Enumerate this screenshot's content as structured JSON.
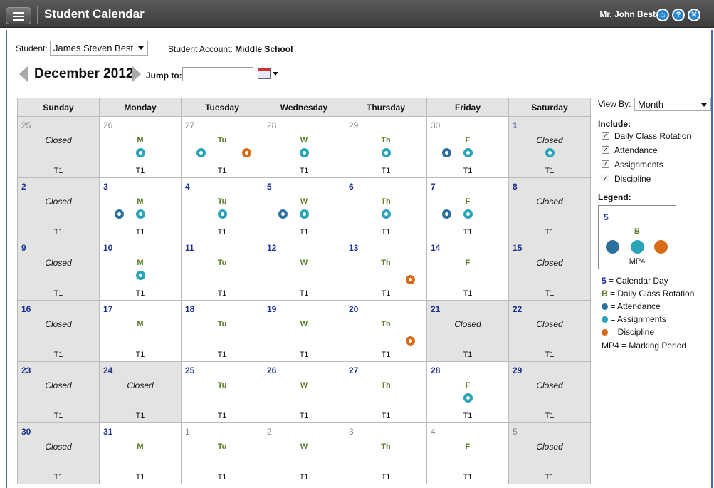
{
  "app": {
    "title": "Student Calendar",
    "user": "Mr. John Best"
  },
  "toolbar": {
    "home_icon": "home-icon",
    "help_icon": "help-icon",
    "close_icon": "close-icon"
  },
  "student": {
    "label": "Student:",
    "value": "James Steven Best",
    "account_label": "Student Account:",
    "account_value": "Middle School"
  },
  "nav": {
    "month": "December 2012",
    "jump_label": "Jump to:",
    "jump_value": ""
  },
  "calendar": {
    "weekdays": [
      "Sunday",
      "Monday",
      "Tuesday",
      "Wednesday",
      "Thursday",
      "Friday",
      "Saturday"
    ],
    "weeks": [
      [
        {
          "d": "25",
          "other": true,
          "closed": true,
          "mp": "T1"
        },
        {
          "d": "26",
          "other": true,
          "rot": "M",
          "icons": [
            "asg"
          ],
          "mp": "T1"
        },
        {
          "d": "27",
          "other": true,
          "rot": "Tu",
          "icons": [
            "asg",
            "dis"
          ],
          "mp": "T1"
        },
        {
          "d": "28",
          "other": true,
          "rot": "W",
          "icons": [
            "asg"
          ],
          "mp": "T1"
        },
        {
          "d": "29",
          "other": true,
          "rot": "Th",
          "icons": [
            "asg"
          ],
          "mp": "T1"
        },
        {
          "d": "30",
          "other": true,
          "rot": "F",
          "icons": [
            "att",
            "asg"
          ],
          "mp": "T1"
        },
        {
          "d": "1",
          "closed": true,
          "icons": [
            "asg"
          ],
          "mp": "T1"
        }
      ],
      [
        {
          "d": "2",
          "closed": true,
          "mp": "T1"
        },
        {
          "d": "3",
          "rot": "M",
          "icons": [
            "att",
            "asg"
          ],
          "mp": "T1"
        },
        {
          "d": "4",
          "rot": "Tu",
          "icons": [
            "asg"
          ],
          "mp": "T1"
        },
        {
          "d": "5",
          "rot": "W",
          "icons": [
            "att",
            "asg"
          ],
          "mp": "T1"
        },
        {
          "d": "6",
          "rot": "Th",
          "icons": [
            "asg"
          ],
          "mp": "T1"
        },
        {
          "d": "7",
          "rot": "F",
          "icons": [
            "att",
            "asg"
          ],
          "mp": "T1"
        },
        {
          "d": "8",
          "closed": true,
          "mp": "T1"
        }
      ],
      [
        {
          "d": "9",
          "closed": true,
          "mp": "T1"
        },
        {
          "d": "10",
          "rot": "M",
          "icons": [
            "asg"
          ],
          "mp": "T1"
        },
        {
          "d": "11",
          "rot": "Tu",
          "mp": "T1"
        },
        {
          "d": "12",
          "rot": "W",
          "mp": "T1"
        },
        {
          "d": "13",
          "rot": "Th",
          "icons": [
            "dis"
          ],
          "mp": "T1"
        },
        {
          "d": "14",
          "rot": "F",
          "mp": "T1"
        },
        {
          "d": "15",
          "closed": true,
          "mp": "T1"
        }
      ],
      [
        {
          "d": "16",
          "closed": true,
          "mp": "T1"
        },
        {
          "d": "17",
          "rot": "M",
          "mp": "T1"
        },
        {
          "d": "18",
          "rot": "Tu",
          "mp": "T1"
        },
        {
          "d": "19",
          "rot": "W",
          "mp": "T1"
        },
        {
          "d": "20",
          "rot": "Th",
          "icons": [
            "dis"
          ],
          "mp": "T1"
        },
        {
          "d": "21",
          "closed": true,
          "mp": "T1"
        },
        {
          "d": "22",
          "closed": true,
          "mp": "T1"
        }
      ],
      [
        {
          "d": "23",
          "closed": true,
          "mp": "T1"
        },
        {
          "d": "24",
          "closed": true,
          "mp": "T1"
        },
        {
          "d": "25",
          "rot": "Tu",
          "mp": "T1"
        },
        {
          "d": "26",
          "rot": "W",
          "mp": "T1"
        },
        {
          "d": "27",
          "rot": "Th",
          "mp": "T1"
        },
        {
          "d": "28",
          "rot": "F",
          "icons": [
            "asg"
          ],
          "mp": "T1"
        },
        {
          "d": "29",
          "closed": true,
          "mp": "T1"
        }
      ],
      [
        {
          "d": "30",
          "closed": true,
          "mp": "T1"
        },
        {
          "d": "31",
          "rot": "M",
          "mp": "T1"
        },
        {
          "d": "1",
          "other": true,
          "rot": "Tu",
          "mp": "T1"
        },
        {
          "d": "2",
          "other": true,
          "rot": "W",
          "mp": "T1"
        },
        {
          "d": "3",
          "other": true,
          "rot": "Th",
          "mp": "T1"
        },
        {
          "d": "4",
          "other": true,
          "rot": "F",
          "mp": "T1"
        },
        {
          "d": "5",
          "other": true,
          "closed": true,
          "mp": "T1"
        }
      ]
    ],
    "closed_text": "Closed"
  },
  "sidebar": {
    "view_by_label": "View By:",
    "view_by_value": "Month",
    "include_title": "Include:",
    "include": [
      {
        "label": "Daily Class Rotation",
        "checked": true
      },
      {
        "label": "Attendance",
        "checked": true
      },
      {
        "label": "Assignments",
        "checked": true
      },
      {
        "label": "Discipline",
        "checked": true
      }
    ],
    "legend_title": "Legend:",
    "legend_sample": {
      "day": "5",
      "rotation": "B",
      "mp": "MP4"
    },
    "legend": [
      {
        "key": "5",
        "text": " = Calendar Day"
      },
      {
        "key": "B",
        "text": " = Daily Class Rotation"
      },
      {
        "key": "",
        "text": " = Attendance"
      },
      {
        "key": "",
        "text": " = Assignments"
      },
      {
        "key": "",
        "text": " = Discipline"
      },
      {
        "key": "MP4",
        "text": " = Marking Period"
      }
    ]
  },
  "colors": {
    "attendance": "#2d70a0",
    "assignments": "#2aa4b9",
    "discipline": "#d76b17",
    "day": "#1b2f8f",
    "rotation": "#5a7a24"
  }
}
